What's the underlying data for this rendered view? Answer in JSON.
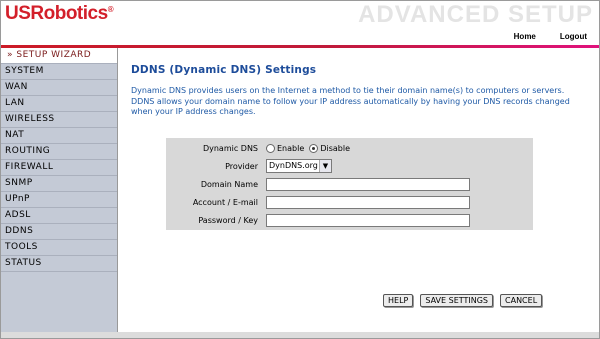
{
  "header": {
    "logo": "USRobotics",
    "logo_mark": "®",
    "banner": "ADVANCED SETUP",
    "links": [
      "Home",
      "Logout"
    ]
  },
  "sidebar": {
    "items": [
      {
        "label": "» SETUP WIZARD",
        "active": true
      },
      {
        "label": "SYSTEM"
      },
      {
        "label": "WAN"
      },
      {
        "label": "LAN"
      },
      {
        "label": "WIRELESS"
      },
      {
        "label": "NAT"
      },
      {
        "label": "ROUTING"
      },
      {
        "label": "FIREWALL"
      },
      {
        "label": "SNMP"
      },
      {
        "label": "UPnP"
      },
      {
        "label": "ADSL"
      },
      {
        "label": "DDNS"
      },
      {
        "label": "TOOLS"
      },
      {
        "label": "STATUS"
      }
    ]
  },
  "main": {
    "title": "DDNS (Dynamic DNS) Settings",
    "description": "Dynamic DNS provides users on the Internet a method to tie their domain name(s) to computers or servers. DDNS allows your domain name to follow your IP address automatically by having your DNS records changed when your IP address changes.",
    "form": {
      "dynamic_dns_label": "Dynamic DNS",
      "enable_label": "Enable",
      "disable_label": "Disable",
      "selected": "Disable",
      "provider_label": "Provider",
      "provider_value": "DynDNS.org",
      "domain_label": "Domain Name",
      "domain_value": "",
      "account_label": "Account / E-mail",
      "account_value": "",
      "password_label": "Password / Key",
      "password_value": ""
    },
    "buttons": {
      "help": "HELP",
      "save": "SAVE SETTINGS",
      "cancel": "CANCEL"
    }
  },
  "colors": {
    "brand_red": "#d31f2a",
    "accent_magenta": "#e0127c",
    "title_blue": "#1d4c9a",
    "sidebar_bg": "#c4cad6"
  }
}
